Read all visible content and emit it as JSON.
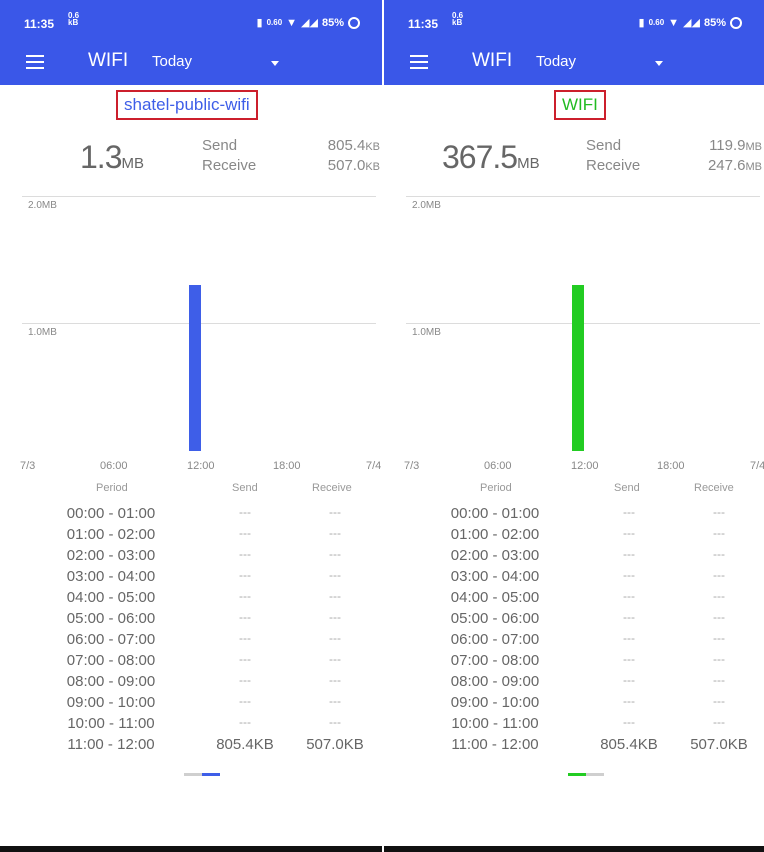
{
  "left": {
    "status": {
      "time": "11:35",
      "speed_top": "0.6",
      "speed_bottom": "kB",
      "net": "0.60",
      "battery": "85%"
    },
    "appbar": {
      "title": "WIFI",
      "period": "Today"
    },
    "network_name": "shatel-public-wifi",
    "accent": "#3e5ee8",
    "total": {
      "value": "1.3",
      "unit": "MB"
    },
    "send": {
      "label": "Send",
      "value": "805.4",
      "unit": "KB"
    },
    "receive": {
      "label": "Receive",
      "value": "507.0",
      "unit": "KB"
    },
    "chart_data": {
      "type": "bar",
      "title": "",
      "xlabel": "",
      "ylabel": "",
      "y_tick_labels": [
        "2.0MB",
        "1.0MB"
      ],
      "x_tick_labels": [
        "7/3",
        "06:00",
        "12:00",
        "18:00",
        "7/4"
      ],
      "ylim": [
        0,
        2.0
      ],
      "x": [
        "11:00-12:00"
      ],
      "values": [
        1.3
      ],
      "color": "#3e5ee8"
    },
    "table": {
      "headers": {
        "period": "Period",
        "send": "Send",
        "receive": "Receive"
      },
      "rows": [
        {
          "period": "00:00 - 01:00",
          "send": "---",
          "receive": "---"
        },
        {
          "period": "01:00 - 02:00",
          "send": "---",
          "receive": "---"
        },
        {
          "period": "02:00 - 03:00",
          "send": "---",
          "receive": "---"
        },
        {
          "period": "03:00 - 04:00",
          "send": "---",
          "receive": "---"
        },
        {
          "period": "04:00 - 05:00",
          "send": "---",
          "receive": "---"
        },
        {
          "period": "05:00 - 06:00",
          "send": "---",
          "receive": "---"
        },
        {
          "period": "06:00 - 07:00",
          "send": "---",
          "receive": "---"
        },
        {
          "period": "07:00 - 08:00",
          "send": "---",
          "receive": "---"
        },
        {
          "period": "08:00 - 09:00",
          "send": "---",
          "receive": "---"
        },
        {
          "period": "09:00 - 10:00",
          "send": "---",
          "receive": "---"
        },
        {
          "period": "10:00 - 11:00",
          "send": "---",
          "receive": "---"
        },
        {
          "period": "11:00 - 12:00",
          "send": "805.4KB",
          "receive": "507.0KB"
        }
      ]
    }
  },
  "right": {
    "status": {
      "time": "11:35",
      "speed_top": "0.6",
      "speed_bottom": "kB",
      "net": "0.60",
      "battery": "85%"
    },
    "appbar": {
      "title": "WIFI",
      "period": "Today"
    },
    "network_name": "WIFI",
    "accent": "#22cc22",
    "total": {
      "value": "367.5",
      "unit": "MB"
    },
    "send": {
      "label": "Send",
      "value": "119.9",
      "unit": "MB"
    },
    "receive": {
      "label": "Receive",
      "value": "247.6",
      "unit": "MB"
    },
    "chart_data": {
      "type": "bar",
      "title": "",
      "xlabel": "",
      "ylabel": "",
      "y_tick_labels": [
        "2.0MB",
        "1.0MB"
      ],
      "x_tick_labels": [
        "7/3",
        "06:00",
        "12:00",
        "18:00",
        "7/4"
      ],
      "ylim": [
        0,
        2.0
      ],
      "x": [
        "11:00-12:00"
      ],
      "values": [
        1.3
      ],
      "color": "#22cc22"
    },
    "table": {
      "headers": {
        "period": "Period",
        "send": "Send",
        "receive": "Receive"
      },
      "rows": [
        {
          "period": "00:00 - 01:00",
          "send": "---",
          "receive": "---"
        },
        {
          "period": "01:00 - 02:00",
          "send": "---",
          "receive": "---"
        },
        {
          "period": "02:00 - 03:00",
          "send": "---",
          "receive": "---"
        },
        {
          "period": "03:00 - 04:00",
          "send": "---",
          "receive": "---"
        },
        {
          "period": "04:00 - 05:00",
          "send": "---",
          "receive": "---"
        },
        {
          "period": "05:00 - 06:00",
          "send": "---",
          "receive": "---"
        },
        {
          "period": "06:00 - 07:00",
          "send": "---",
          "receive": "---"
        },
        {
          "period": "07:00 - 08:00",
          "send": "---",
          "receive": "---"
        },
        {
          "period": "08:00 - 09:00",
          "send": "---",
          "receive": "---"
        },
        {
          "period": "09:00 - 10:00",
          "send": "---",
          "receive": "---"
        },
        {
          "period": "10:00 - 11:00",
          "send": "---",
          "receive": "---"
        },
        {
          "period": "11:00 - 12:00",
          "send": "805.4KB",
          "receive": "507.0KB"
        }
      ]
    }
  }
}
